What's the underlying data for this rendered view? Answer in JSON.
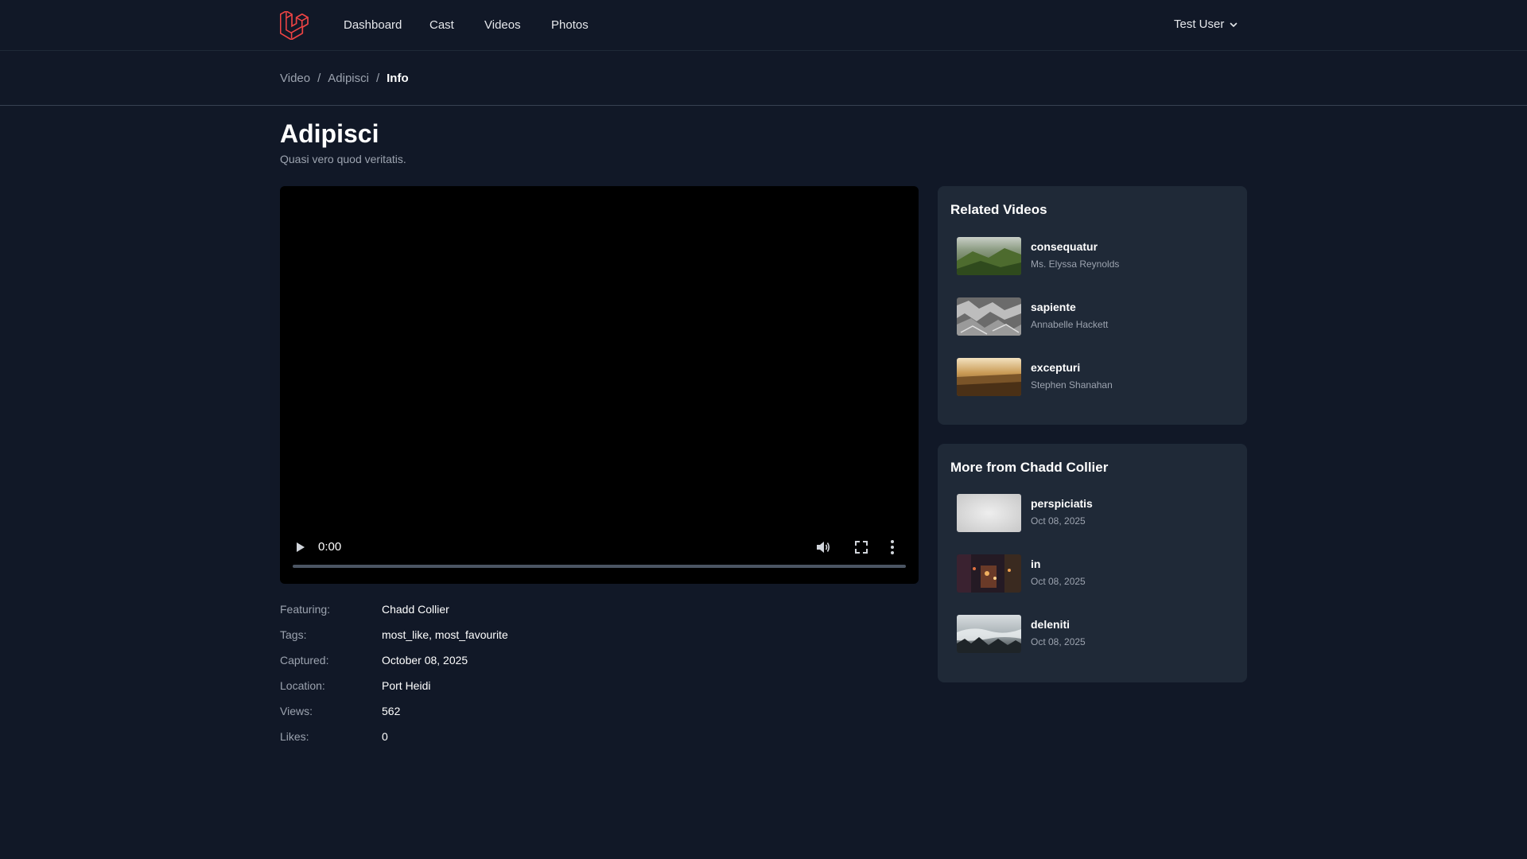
{
  "nav": {
    "links": [
      "Dashboard",
      "Cast",
      "Videos",
      "Photos"
    ],
    "user": "Test User"
  },
  "breadcrumb": [
    "Video",
    "Adipisci",
    "Info"
  ],
  "page": {
    "title": "Adipisci",
    "subtitle": "Quasi vero quod veritatis."
  },
  "player": {
    "time": "0:00",
    "progress": 0
  },
  "meta": [
    {
      "label": "Featuring:",
      "value": "Chadd Collier"
    },
    {
      "label": "Tags:",
      "value": "most_like, most_favourite"
    },
    {
      "label": "Captured:",
      "value": "October 08, 2025"
    },
    {
      "label": "Location:",
      "value": "Port Heidi"
    },
    {
      "label": "Views:",
      "value": "562"
    },
    {
      "label": "Likes:",
      "value": "0"
    }
  ],
  "related": {
    "title": "Related Videos",
    "items": [
      {
        "title": "consequatur",
        "sub": "Ms. Elyssa Reynolds"
      },
      {
        "title": "sapiente",
        "sub": "Annabelle Hackett"
      },
      {
        "title": "excepturi",
        "sub": "Stephen Shanahan"
      }
    ]
  },
  "more": {
    "title": "More from Chadd Collier",
    "items": [
      {
        "title": "perspiciatis",
        "sub": "Oct 08, 2025"
      },
      {
        "title": "in",
        "sub": "Oct 08, 2025"
      },
      {
        "title": "deleniti",
        "sub": "Oct 08, 2025"
      }
    ]
  },
  "colors": {
    "background": "#111827",
    "panel": "#1f2937",
    "brand": "#ef4444"
  },
  "icons": [
    "laravel-logo-icon",
    "chevron-down-icon",
    "play-icon",
    "volume-icon",
    "fullscreen-icon",
    "more-vertical-icon"
  ]
}
